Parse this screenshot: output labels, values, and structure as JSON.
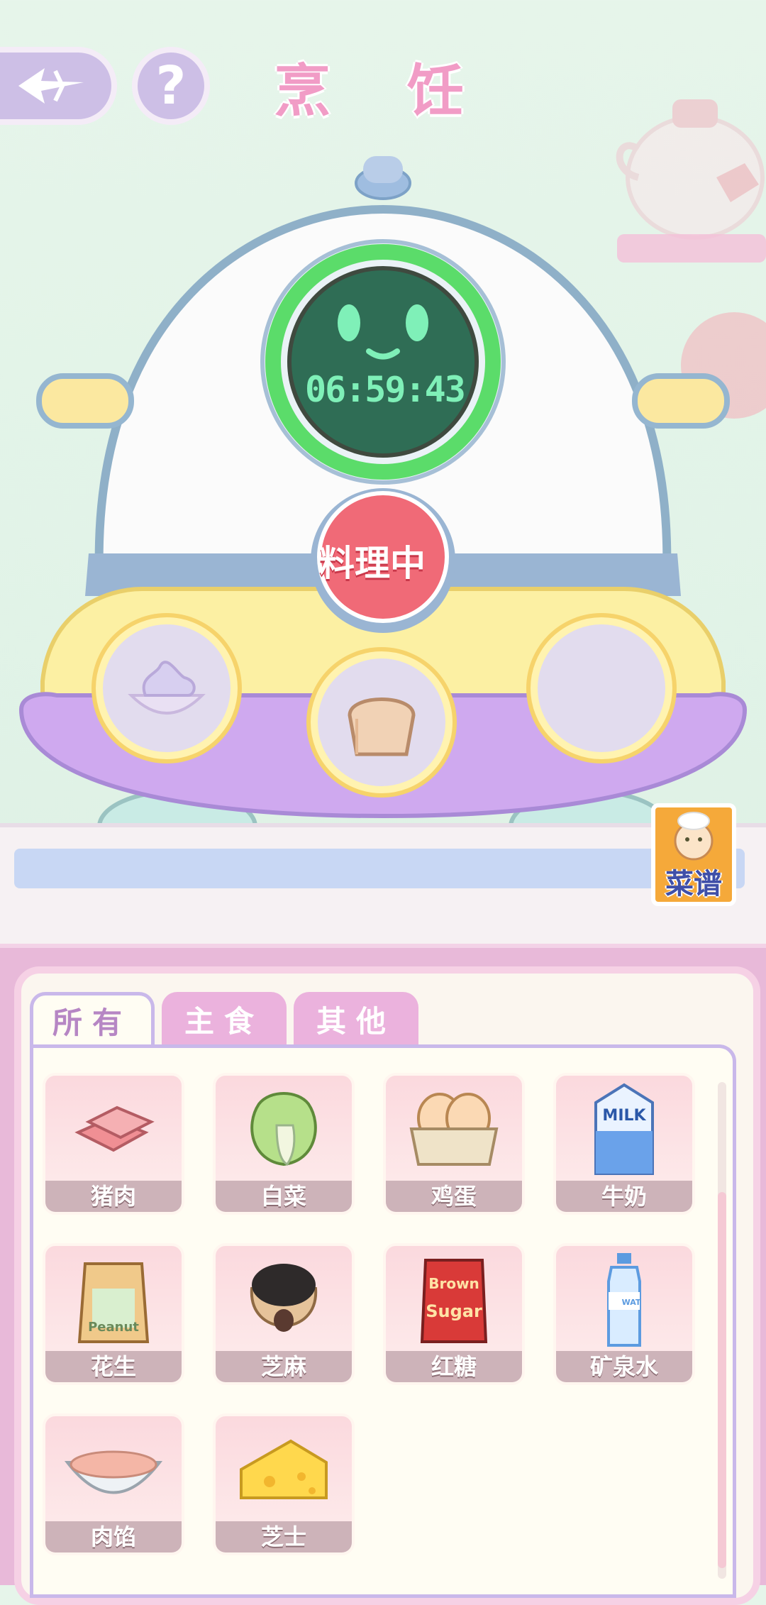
{
  "header": {
    "title": "烹 饪",
    "help_label": "?"
  },
  "cooker": {
    "timer": "06:59:43",
    "status_button": "料理中"
  },
  "recipe_button": {
    "label": "菜谱"
  },
  "tabs": [
    {
      "label": "所有",
      "active": true
    },
    {
      "label": "主食",
      "active": false
    },
    {
      "label": "其他",
      "active": false
    }
  ],
  "ingredients": [
    {
      "name": "猪肉",
      "icon": "pork-icon"
    },
    {
      "name": "白菜",
      "icon": "cabbage-icon"
    },
    {
      "name": "鸡蛋",
      "icon": "eggs-icon"
    },
    {
      "name": "牛奶",
      "icon": "milk-carton-icon"
    },
    {
      "name": "花生",
      "icon": "peanut-bag-icon"
    },
    {
      "name": "芝麻",
      "icon": "sesame-sack-icon"
    },
    {
      "name": "红糖",
      "icon": "brown-sugar-bag-icon"
    },
    {
      "name": "矿泉水",
      "icon": "water-bottle-icon"
    },
    {
      "name": "肉馅",
      "icon": "minced-meat-bowl-icon"
    },
    {
      "name": "芝士",
      "icon": "cheese-icon"
    }
  ],
  "slots": [
    {
      "icon": "cream-bowl-icon"
    },
    {
      "icon": "bread-icon"
    },
    {
      "icon": "empty-slot"
    }
  ],
  "item_labels": {
    "milk_carton": "MILK",
    "peanut_bag": "Peanut",
    "brown_sugar_top": "Brown",
    "brown_sugar_bottom": "Sugar",
    "water_bottle": "WAT"
  },
  "colors": {
    "title": "#f19cc6",
    "panel": "#e8b9d9",
    "screen": "#2f6d55",
    "ring": "#5bdc6a",
    "button": "#f06a77"
  }
}
